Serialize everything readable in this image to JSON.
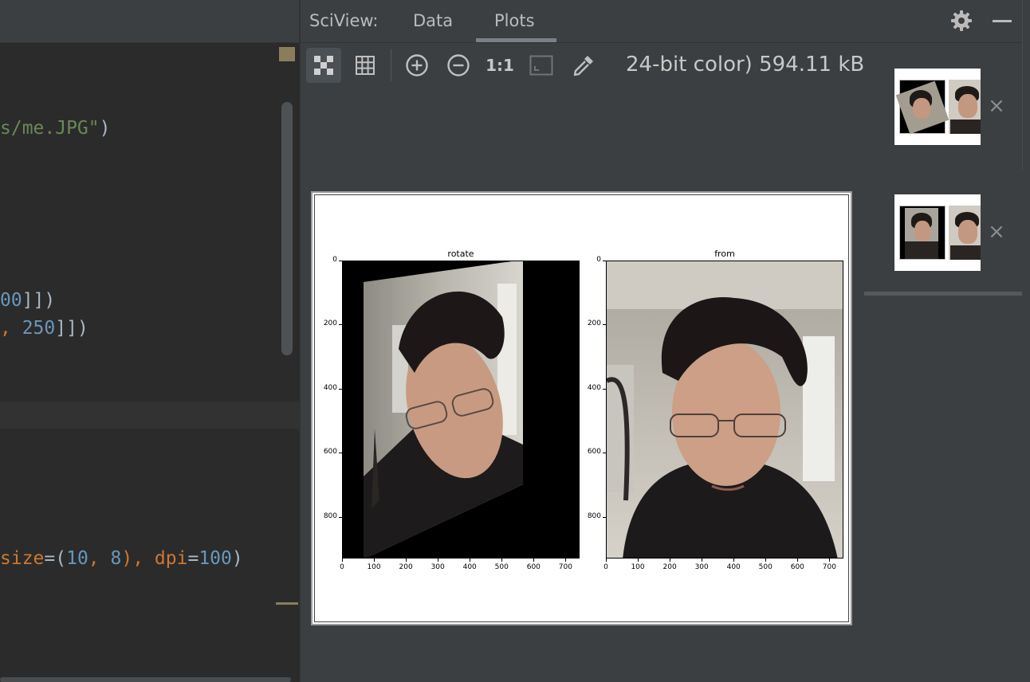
{
  "editor": {
    "lines": [
      {
        "segments": [
          {
            "t": "s/me.JPG\"",
            "c": "str"
          },
          {
            "t": ")",
            "c": "txt"
          }
        ]
      },
      {
        "segments": [
          {
            "t": "00",
            "c": "num"
          },
          {
            "t": "]])",
            "c": "txt"
          }
        ]
      },
      {
        "segments": [
          {
            "t": ", ",
            "c": "kw"
          },
          {
            "t": "250",
            "c": "num"
          },
          {
            "t": "]])",
            "c": "txt"
          }
        ]
      },
      {
        "segments": [
          {
            "t": "size",
            "c": "kw"
          },
          {
            "t": "=(",
            "c": "txt"
          },
          {
            "t": "10",
            "c": "num"
          },
          {
            "t": ", ",
            "c": "kw"
          },
          {
            "t": "8",
            "c": "num"
          },
          {
            "t": "), ",
            "c": "kw"
          },
          {
            "t": "dpi",
            "c": "kw"
          },
          {
            "t": "=",
            "c": "txt"
          },
          {
            "t": "100",
            "c": "num"
          },
          {
            "t": ")",
            "c": "txt"
          }
        ]
      }
    ]
  },
  "sciview": {
    "title": "SciView:",
    "tabs": [
      {
        "label": "Data",
        "active": false
      },
      {
        "label": "Plots",
        "active": true
      }
    ],
    "toolbar": {
      "actual_size_label": "1:1",
      "image_info": "24-bit color) 594.11 kB"
    },
    "thumbnails": [
      {
        "close": "×"
      },
      {
        "close": "×"
      }
    ]
  },
  "colors": {
    "panel_bg": "#3c3f41",
    "editor_bg": "#2b2b2b",
    "string": "#6a8759",
    "number": "#6897bb",
    "keyword": "#cc7832"
  },
  "chart_data": [
    {
      "type": "image",
      "title": "rotate",
      "xticks": [
        0,
        100,
        200,
        300,
        400,
        500,
        600,
        700
      ],
      "yticks": [
        0,
        200,
        400,
        600,
        800
      ],
      "xlim": [
        0,
        744
      ],
      "ylim": [
        930,
        0
      ]
    },
    {
      "type": "image",
      "title": "from",
      "xticks": [
        0,
        100,
        200,
        300,
        400,
        500,
        600,
        700
      ],
      "yticks": [
        0,
        200,
        400,
        600,
        800
      ],
      "xlim": [
        0,
        744
      ],
      "ylim": [
        930,
        0
      ]
    }
  ]
}
